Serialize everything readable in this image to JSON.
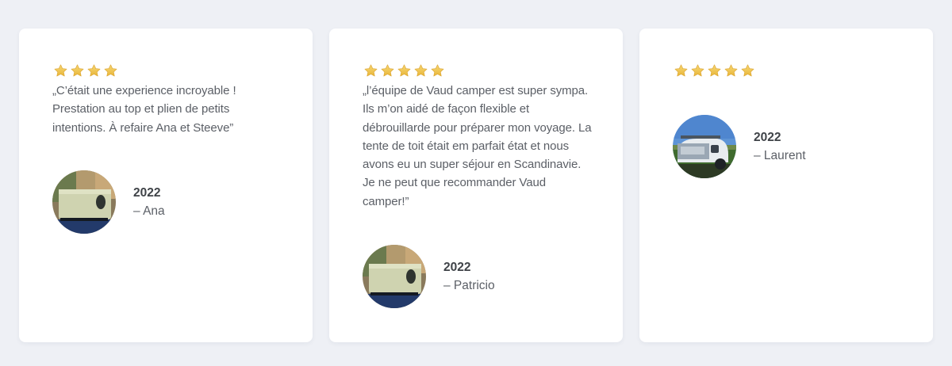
{
  "testimonials": [
    {
      "rating": 4,
      "quote": "„C’était une experience incroyable ! Prestation au top et plien de petits intentions. À refaire Ana et Steeve”",
      "year": "2022",
      "author": "– Ana",
      "avatar_icon": "rooftop-tent-photo"
    },
    {
      "rating": 5,
      "quote": "„l’équipe de Vaud camper est super sympa. Ils m’on aidé de façon flexible et débrouillarde pour préparer mon voyage. La tente de toit était em parfait état et nous avons eu un super séjour en Scandinavie. Je ne peut que recommander Vaud camper!”",
      "year": "2022",
      "author": "– Patricio",
      "avatar_icon": "rooftop-tent-photo"
    },
    {
      "rating": 5,
      "quote": "",
      "year": "2022",
      "author": "– Laurent",
      "avatar_icon": "teardrop-trailer-photo"
    }
  ],
  "colors": {
    "background": "#eef0f5",
    "card": "#ffffff",
    "star": "#f2c94c",
    "text": "#5b5f66",
    "heading": "#3f4348"
  }
}
